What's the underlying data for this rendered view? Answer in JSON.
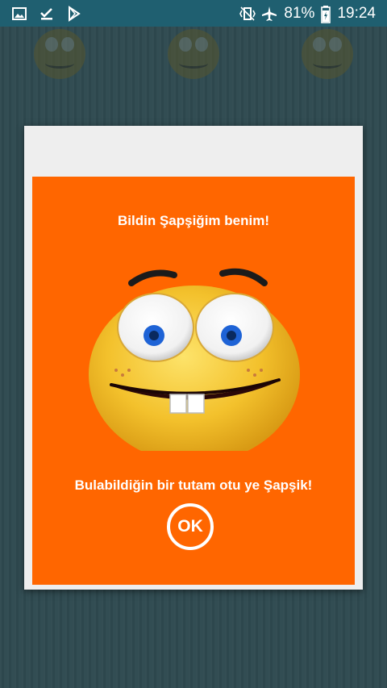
{
  "status_bar": {
    "battery": "81%",
    "time": "19:24"
  },
  "dialog": {
    "title": "Bildin Şapşiğim benim!",
    "message": "Bulabildiğin bir tutam otu ye Şapşik!",
    "ok_label": "OK"
  },
  "colors": {
    "status_bar": "#1f5f70",
    "panel": "#ff6600",
    "dialog_frame": "#eeeeee"
  }
}
